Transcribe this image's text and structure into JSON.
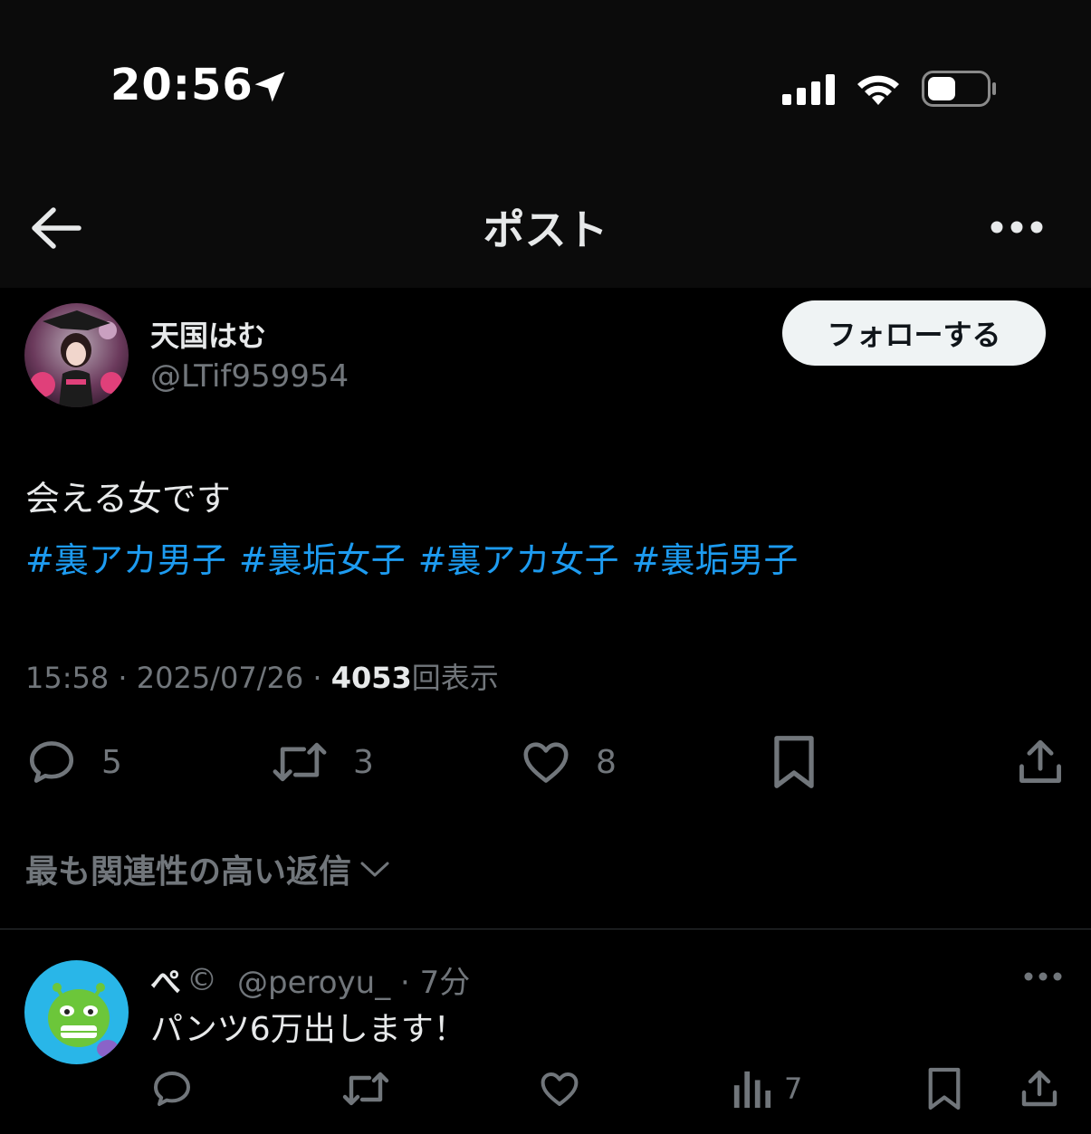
{
  "status_bar": {
    "time": "20:56"
  },
  "header": {
    "title": "ポスト"
  },
  "author": {
    "name": "天国はむ",
    "handle": "@LTif959954",
    "follow_label": "フォローする"
  },
  "post": {
    "text": "会える女です",
    "hashtags": [
      "#裏アカ男子",
      "#裏垢女子",
      "#裏アカ女子",
      "#裏垢男子"
    ],
    "time": "15:58 · 2025/07/26 · ",
    "views_count": "4053",
    "views_label": "回表示"
  },
  "actions": {
    "replies": "5",
    "reposts": "3",
    "likes": "8"
  },
  "replies_sort": {
    "label": "最も関連性の高い返信"
  },
  "reply": {
    "name": "ぺ",
    "badge": "©",
    "handle_time": "@peroyu_ · 7分",
    "text": "パンツ6万出します！",
    "views": "7"
  },
  "colors": {
    "accent": "#1d9bf0",
    "muted": "#71767b",
    "text": "#e7e9ea",
    "background": "#000000"
  }
}
